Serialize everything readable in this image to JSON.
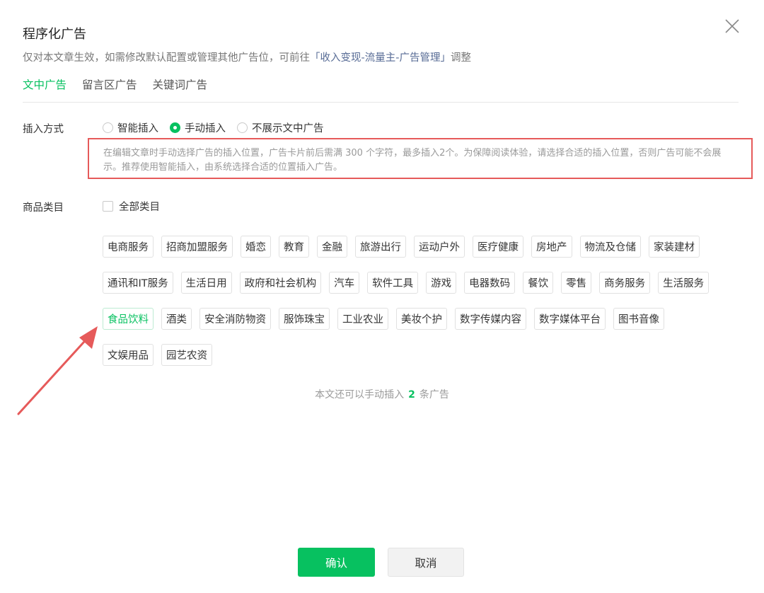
{
  "dialog": {
    "title": "程序化广告",
    "desc_prefix": "仅对本文章生效，如需修改默认配置或管理其他广告位，可前往",
    "desc_link": "「收入变现-流量主-广告管理」",
    "desc_suffix": "调整"
  },
  "tabs": [
    {
      "label": "文中广告",
      "active": true
    },
    {
      "label": "留言区广告",
      "active": false
    },
    {
      "label": "关键词广告",
      "active": false
    }
  ],
  "insert_mode": {
    "label": "插入方式",
    "options": [
      {
        "label": "智能插入",
        "selected": false
      },
      {
        "label": "手动插入",
        "selected": true
      },
      {
        "label": "不展示文中广告",
        "selected": false
      }
    ],
    "hint": "在编辑文章时手动选择广告的插入位置，广告卡片前后需满 300 个字符，最多插入2个。为保障阅读体验，请选择合适的插入位置，否则广告可能不会展示。推荐使用智能插入，由系统选择合适的位置插入广告。"
  },
  "category": {
    "label": "商品类目",
    "all_label": "全部类目",
    "rows": [
      [
        "电商服务",
        "招商加盟服务",
        "婚恋",
        "教育",
        "金融",
        "旅游出行",
        "运动户外",
        "医疗健康",
        "房地产",
        "物流及仓储",
        "家装建材"
      ],
      [
        "通讯和IT服务",
        "生活日用",
        "政府和社会机构",
        "汽车",
        "软件工具",
        "游戏",
        "电器数码",
        "餐饮",
        "零售",
        "商务服务",
        "生活服务"
      ],
      [
        "食品饮料",
        "酒类",
        "安全消防物资",
        "服饰珠宝",
        "工业农业",
        "美妆个护",
        "数字传媒内容",
        "数字媒体平台",
        "图书音像"
      ],
      [
        "文娱用品",
        "园艺农资"
      ]
    ],
    "selected": "食品饮料"
  },
  "remaining": {
    "prefix": "本文还可以手动插入",
    "count": "2",
    "suffix": "条广告"
  },
  "buttons": {
    "confirm": "确认",
    "cancel": "取消"
  },
  "colors": {
    "accent": "#07c160",
    "link": "#576b95",
    "annotation": "#e65a5a"
  }
}
